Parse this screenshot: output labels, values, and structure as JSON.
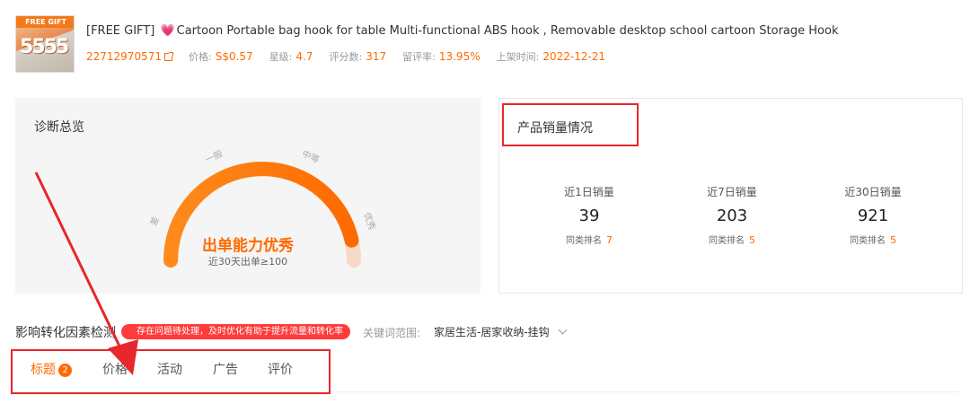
{
  "product": {
    "thumb_banner": "FREE GIFT",
    "thumb_text": "5555",
    "gift_tag": "[FREE GIFT]",
    "name": "Cartoon Portable bag hook for table Multi-functional ABS hook , Removable desktop school cartoon Storage Hook",
    "id": "22712970571",
    "price_label": "价格:",
    "price": "S$0.57",
    "rating_label": "星级:",
    "rating": "4.7",
    "reviews_label": "评分数:",
    "reviews": "317",
    "retention_label": "留评率:",
    "retention": "13.95%",
    "listed_label": "上架时间:",
    "listed": "2022-12-21"
  },
  "diagnosis": {
    "title": "诊断总览",
    "levels": [
      "差",
      "一般",
      "中等",
      "优秀"
    ],
    "verdict": "出单能力优秀",
    "verdict_sub": "近30天出单≥100",
    "gauge_level": 0.93,
    "colors": {
      "start": "#ff8a1c",
      "end": "#ff6a00",
      "track": "#f7d7c6"
    }
  },
  "sales": {
    "title": "产品销量情况",
    "stats": [
      {
        "label": "近1日销量",
        "value": "39",
        "rank_label": "同类排名",
        "rank": "7"
      },
      {
        "label": "近7日销量",
        "value": "203",
        "rank_label": "同类排名",
        "rank": "5"
      },
      {
        "label": "近30日销量",
        "value": "921",
        "rank_label": "同类排名",
        "rank": "5"
      }
    ]
  },
  "factors": {
    "title": "影响转化因素检测",
    "tip": "存在问题待处理，及时优化有助于提升流量和转化率",
    "scope_label": "关键词范围:",
    "scope_value": "家居生活-居家收纳-挂钩"
  },
  "tabs": [
    {
      "label": "标题",
      "badge": "2",
      "active": true
    },
    {
      "label": "价格"
    },
    {
      "label": "活动"
    },
    {
      "label": "广告"
    },
    {
      "label": "评价"
    }
  ],
  "accent": "#ff6a00",
  "annotation_color": "#e8262b"
}
